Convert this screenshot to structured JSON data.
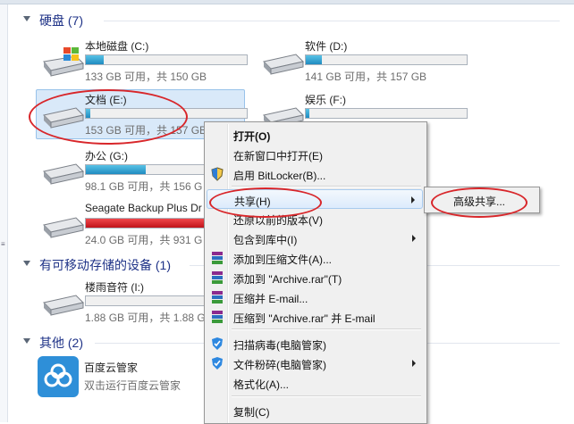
{
  "groups": {
    "hdd": "硬盘 (7)",
    "removable": "有可移动存储的设备 (1)",
    "other": "其他 (2)"
  },
  "drives": [
    {
      "name": "本地磁盘 (C:)",
      "info": "133 GB 可用，共 150 GB",
      "used_fraction": 0.11
    },
    {
      "name": "软件 (D:)",
      "info": "141 GB 可用，共 157 GB",
      "used_fraction": 0.1
    },
    {
      "name": "文档 (E:)",
      "info": "153 GB 可用，共 157 GB",
      "used_fraction": 0.03
    },
    {
      "name": "娱乐 (F:)",
      "info": "",
      "used_fraction": 0.02
    },
    {
      "name": "办公 (G:)",
      "info": "98.1 GB 可用，共 156 G",
      "used_fraction": 0.37
    },
    {
      "name": "Seagate Backup Plus Dr",
      "info": "24.0 GB 可用，共 931 G",
      "used_fraction": 0.97,
      "color": "#d8262a"
    },
    {
      "name": "楼雨音符 (I:)",
      "info": "1.88 GB 可用，共 1.88 G",
      "used_fraction": 0.0
    }
  ],
  "other_items": [
    {
      "name": "百度云管家",
      "desc": "双击运行百度云管家"
    }
  ],
  "context_menu": [
    {
      "label": "打开(O)",
      "bold": true
    },
    {
      "label": "在新窗口中打开(E)"
    },
    {
      "label": "启用 BitLocker(B)...",
      "icon": "shield-icon"
    },
    {
      "label": "共享(H)",
      "submenu": true,
      "highlight": true
    },
    {
      "label": "还原以前的版本(V)"
    },
    {
      "label": "包含到库中(I)",
      "submenu": true
    },
    {
      "label": "添加到压缩文件(A)...",
      "icon": "winrar-icon"
    },
    {
      "label": "添加到 \"Archive.rar\"(T)",
      "icon": "winrar-icon"
    },
    {
      "label": "压缩并 E-mail...",
      "icon": "winrar-icon"
    },
    {
      "label": "压缩到 \"Archive.rar\" 并 E-mail",
      "icon": "winrar-icon"
    },
    {
      "label": "扫描病毒(电脑管家)",
      "icon": "guard-icon"
    },
    {
      "label": "文件粉碎(电脑管家)",
      "icon": "guard-icon",
      "submenu": true
    },
    {
      "label": "格式化(A)..."
    },
    {
      "label": "复制(C)"
    }
  ],
  "submenu": {
    "label": "高级共享..."
  },
  "colors": {
    "accent": "#1f8bc0",
    "annotation": "#d8262a",
    "selection": "#d9e9f9"
  }
}
